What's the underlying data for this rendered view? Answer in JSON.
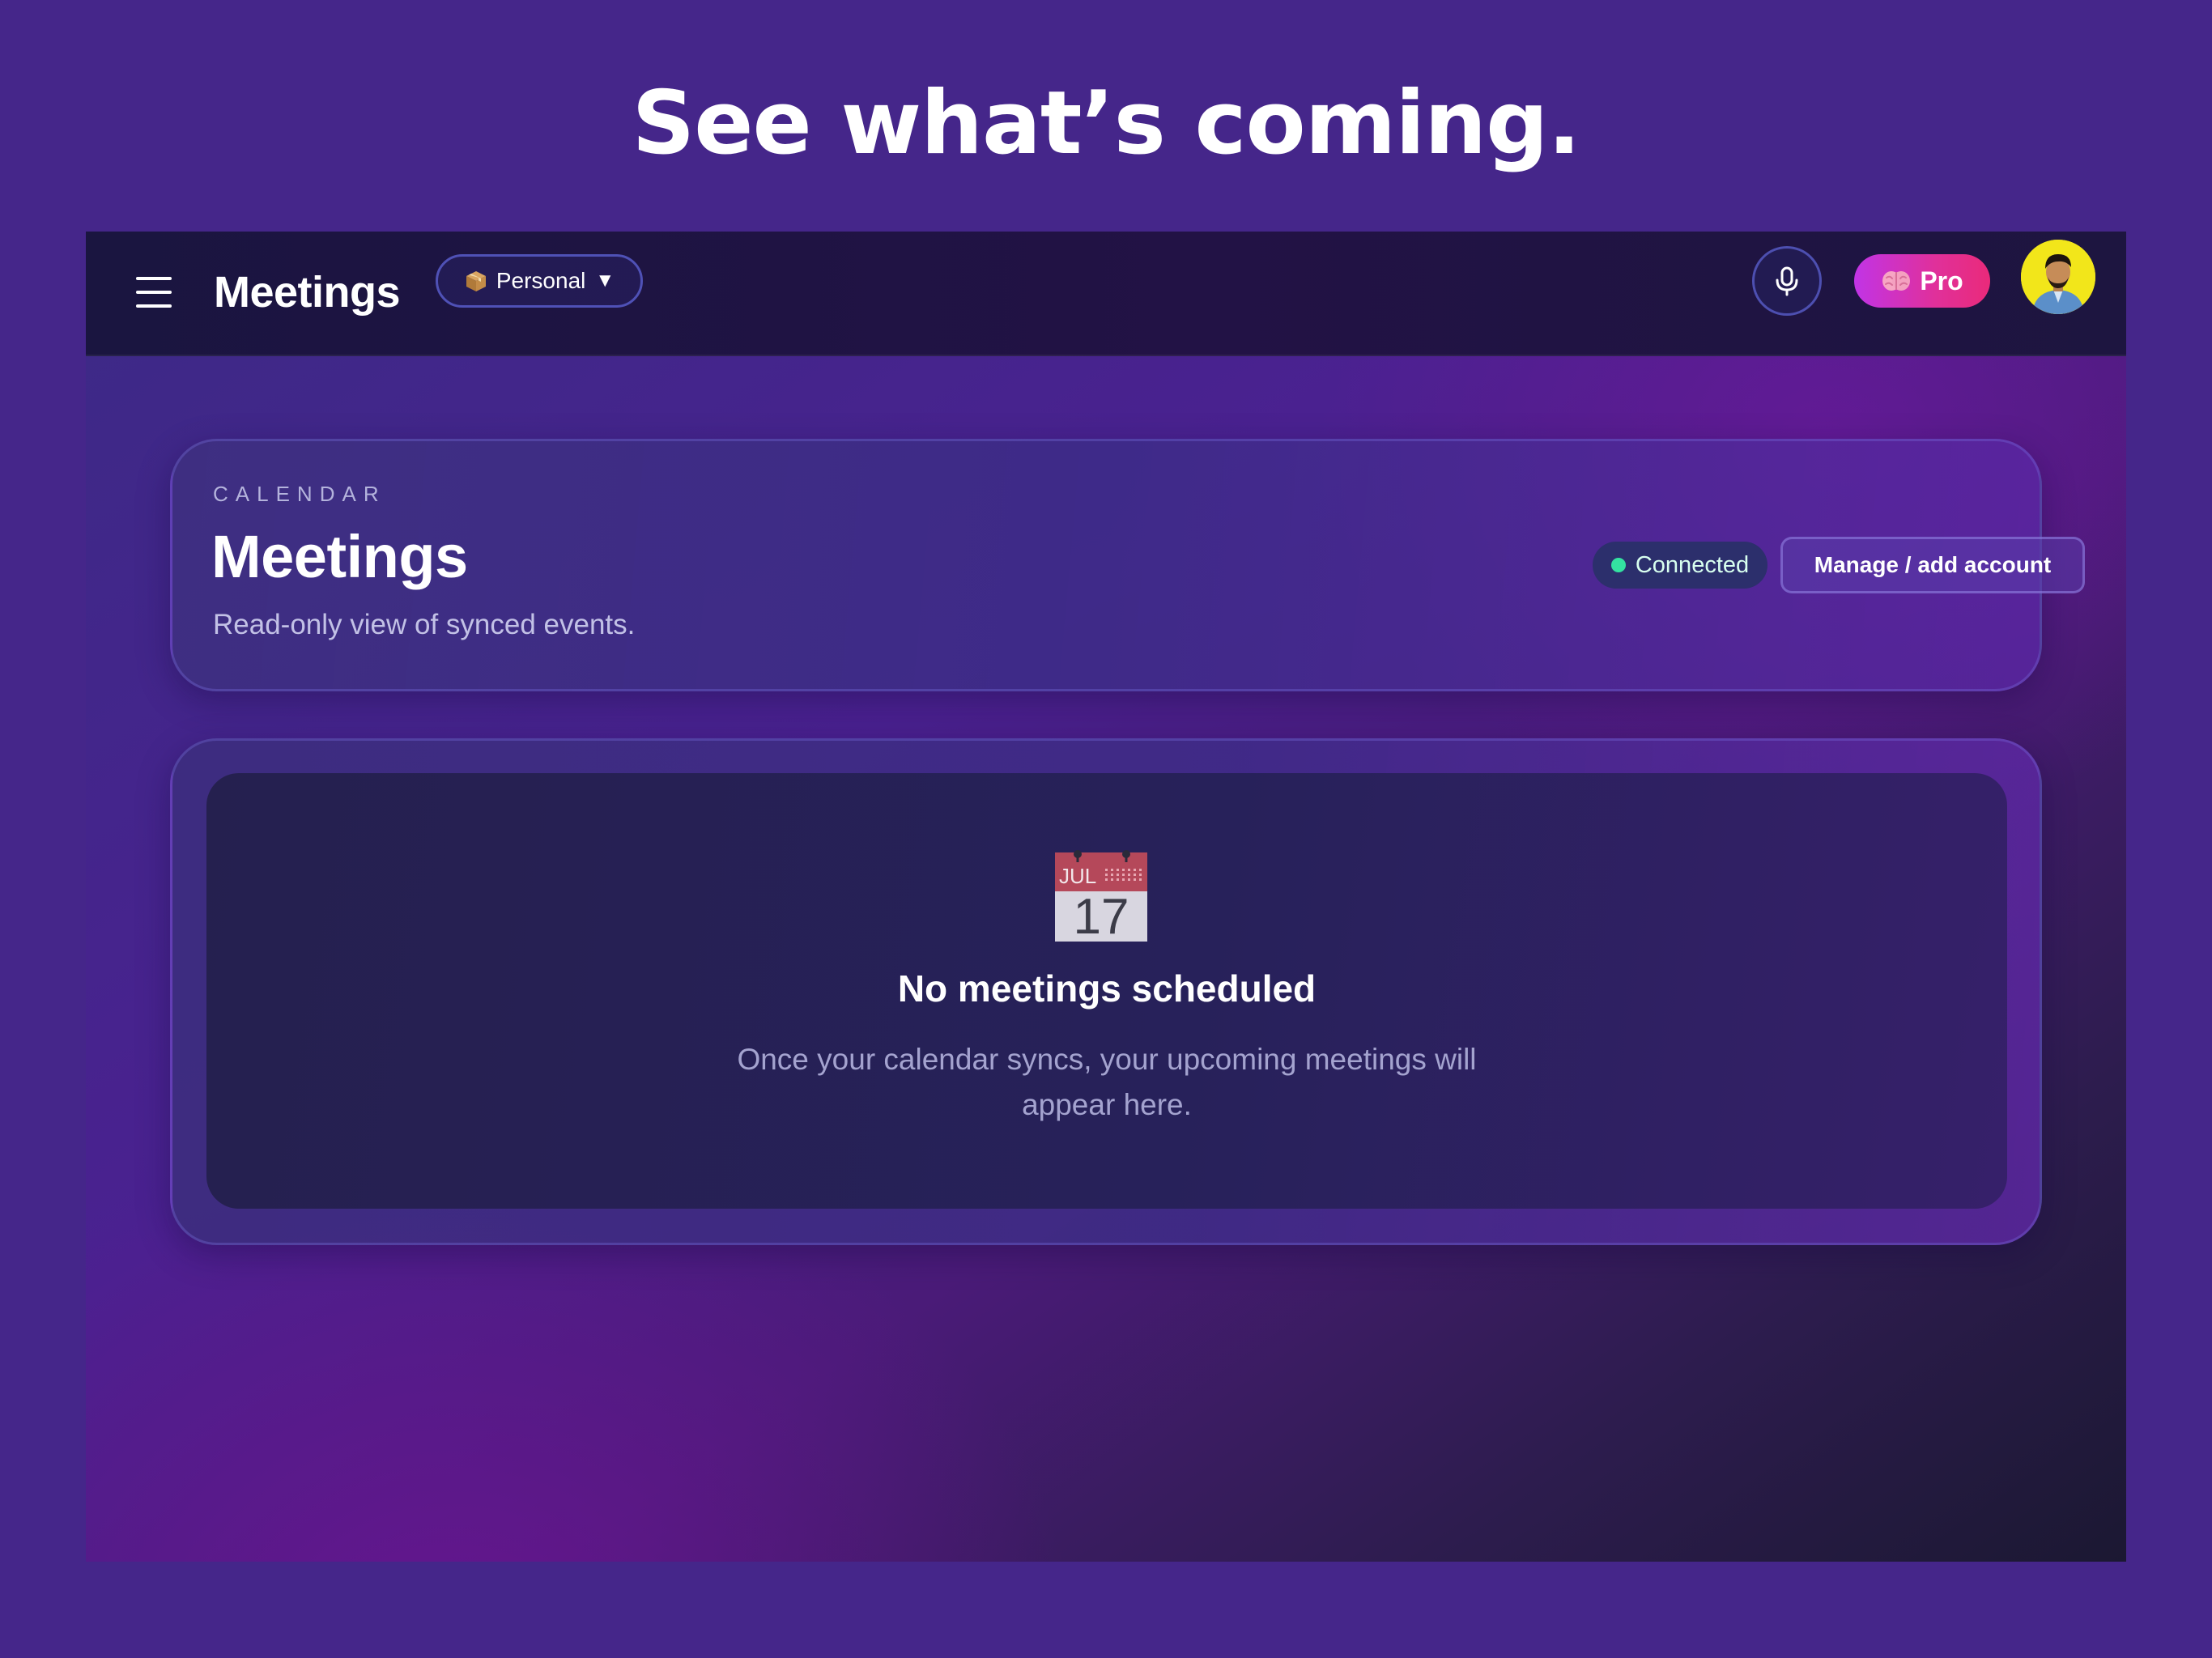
{
  "hero": {
    "title": "See what’s coming."
  },
  "topbar": {
    "menu_icon": "hamburger-menu-icon",
    "title": "Meetings",
    "workspace": {
      "icon": "package-box-icon",
      "label": "Personal",
      "caret": "▼"
    },
    "mic_icon": "microphone-icon",
    "pro": {
      "icon": "brain-icon",
      "label": "Pro"
    },
    "avatar_icon": "user-avatar"
  },
  "header_card": {
    "eyebrow": "CALENDAR",
    "title": "Meetings",
    "subtitle": "Read-only view of synced events.",
    "status": {
      "label": "Connected",
      "color": "#34e2a1"
    },
    "manage_button": "Manage / add account"
  },
  "empty_state": {
    "icon": "calendar-icon",
    "calendar_month": "JUL",
    "calendar_day": "17",
    "title": "No meetings scheduled",
    "description": "Once your calendar syncs, your upcoming meetings will appear here."
  },
  "colors": {
    "background": "#45268a",
    "accent_pink": "#e0309a",
    "status_green": "#34e2a1"
  }
}
